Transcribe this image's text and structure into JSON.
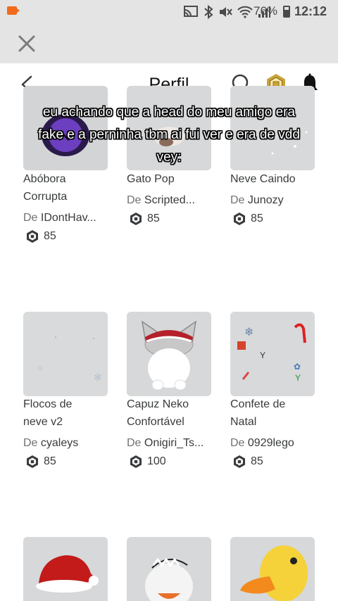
{
  "status_bar": {
    "battery": "76%",
    "time": "12:12"
  },
  "header": {
    "title": "Perfil"
  },
  "caption": {
    "line1": "eu achando que a head do meu amigo era",
    "line2": "fake e a perninha tbm ai fui ver e era de vdd",
    "line3": "vey:"
  },
  "items": [
    {
      "name_line1": "Abóbora",
      "name_line2": "Corrupta",
      "prefix": "De",
      "creator": "IDontHav...",
      "price": "85"
    },
    {
      "name_line1": "Gato Pop",
      "name_line2": "",
      "prefix": "De",
      "creator": "Scripted...",
      "price": "85"
    },
    {
      "name_line1": "Neve Caindo",
      "name_line2": "",
      "prefix": "De",
      "creator": "Junozy",
      "price": "85"
    },
    {
      "name_line1": "Flocos de",
      "name_line2": "neve v2",
      "prefix": "De",
      "creator": "cyaleys",
      "price": "85"
    },
    {
      "name_line1": "Capuz Neko",
      "name_line2": "Confortável",
      "prefix": "De",
      "creator": "Onigiri_Ts...",
      "price": "100"
    },
    {
      "name_line1": "Confete de",
      "name_line2": "Natal",
      "prefix": "De",
      "creator": "0929lego",
      "price": "85"
    }
  ],
  "colors": {
    "status_bar_bg": "#e4e4e4",
    "thumb_bg": "#d6d8da",
    "robux_gold": "#c9a43a"
  }
}
